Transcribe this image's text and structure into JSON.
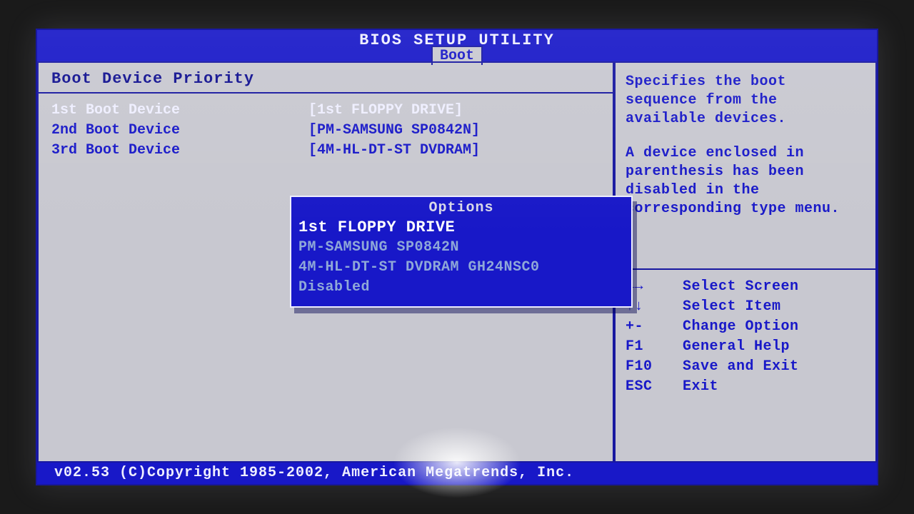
{
  "title": "BIOS SETUP UTILITY",
  "tab": "Boot",
  "section_title": "Boot Device Priority",
  "rows": [
    {
      "label": "1st Boot Device",
      "value": "[1st FLOPPY DRIVE]",
      "selected": true
    },
    {
      "label": "2nd Boot Device",
      "value": "[PM-SAMSUNG SP0842N]",
      "selected": false
    },
    {
      "label": "3rd Boot Device",
      "value": "[4M-HL-DT-ST DVDRAM]",
      "selected": false
    }
  ],
  "popup": {
    "title": "Options",
    "items": [
      {
        "text": "1st FLOPPY DRIVE",
        "selected": true
      },
      {
        "text": "PM-SAMSUNG SP0842N",
        "selected": false
      },
      {
        "text": "4M-HL-DT-ST DVDRAM GH24NSC0",
        "selected": false
      },
      {
        "text": "Disabled",
        "selected": false
      }
    ]
  },
  "help": {
    "p1": "Specifies the boot sequence from the available devices.",
    "p2": "A device enclosed in parenthesis has been disabled in the corresponding type menu."
  },
  "hints": [
    {
      "key": "←→",
      "desc": "Select Screen"
    },
    {
      "key": "↑↓",
      "desc": "Select Item"
    },
    {
      "key": "+-",
      "desc": "Change Option"
    },
    {
      "key": "F1",
      "desc": "General Help"
    },
    {
      "key": "F10",
      "desc": "Save and Exit"
    },
    {
      "key": "ESC",
      "desc": "Exit"
    }
  ],
  "footer": "v02.53  (C)Copyright 1985-2002, American Megatrends, Inc."
}
